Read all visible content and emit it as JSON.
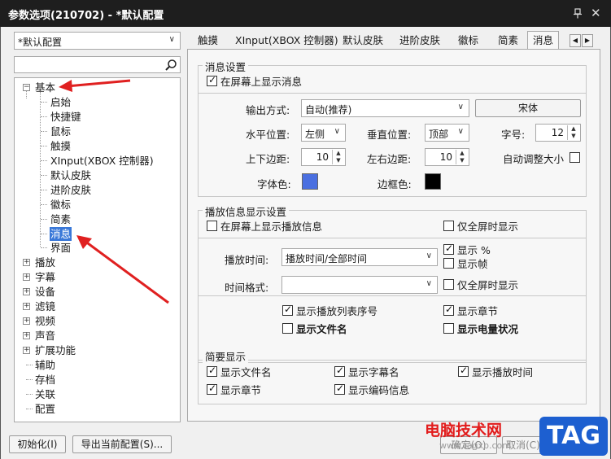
{
  "window": {
    "title": "参数选项(210702) - *默认配置"
  },
  "left": {
    "profile_value": "*默认配置",
    "search_value": "",
    "tree": [
      {
        "label": "基本",
        "expander": "−"
      },
      {
        "label": "启始"
      },
      {
        "label": "快捷键"
      },
      {
        "label": "鼠标"
      },
      {
        "label": "触摸"
      },
      {
        "label": "XInput(XBOX 控制器)"
      },
      {
        "label": "默认皮肤"
      },
      {
        "label": "进阶皮肤"
      },
      {
        "label": "徽标"
      },
      {
        "label": "简素"
      },
      {
        "label": "消息",
        "selected": true
      },
      {
        "label": "界面"
      },
      {
        "label": "播放",
        "expander": "+"
      },
      {
        "label": "字幕",
        "expander": "+"
      },
      {
        "label": "设备",
        "expander": "+"
      },
      {
        "label": "滤镜",
        "expander": "+"
      },
      {
        "label": "视频",
        "expander": "+"
      },
      {
        "label": "声音",
        "expander": "+"
      },
      {
        "label": "扩展功能",
        "expander": "+"
      },
      {
        "label": "辅助"
      },
      {
        "label": "存档"
      },
      {
        "label": "关联"
      },
      {
        "label": "配置"
      }
    ]
  },
  "tabs": [
    "触摸",
    "XInput(XBOX 控制器)",
    "默认皮肤",
    "进阶皮肤",
    "徽标",
    "简素",
    "消息"
  ],
  "message_settings": {
    "title": "消息设置",
    "show_on_screen": {
      "label": "在屏幕上显示消息",
      "checked": true
    },
    "output_label": "输出方式:",
    "output_value": "自动(推荐)",
    "font_button": "宋体",
    "hpos_label": "水平位置:",
    "hpos_value": "左侧",
    "vpos_label": "垂直位置:",
    "vpos_value": "顶部",
    "size_label": "字号:",
    "size_value": "12",
    "vmargin_label": "上下边距:",
    "vmargin_value": "10",
    "hmargin_label": "左右边距:",
    "hmargin_value": "10",
    "autosize": {
      "label": "自动调整大小",
      "checked": false
    },
    "font_color_label": "字体色:",
    "font_color": "#4a6fe0",
    "border_color_label": "边框色:",
    "border_color": "#000000"
  },
  "playinfo": {
    "title": "播放信息显示设置",
    "show_playinfo": {
      "label": "在屏幕上显示播放信息",
      "checked": false
    },
    "fullscreen_only_1": {
      "label": "仅全屏时显示",
      "checked": false
    },
    "playtime_label": "播放时间:",
    "playtime_value": "播放时间/全部时间",
    "show_percent": {
      "label": "显示 %",
      "checked": true
    },
    "show_frame": {
      "label": "显示帧",
      "checked": false
    },
    "timefmt_label": "时间格式:",
    "timefmt_value": "",
    "fullscreen_only_2": {
      "label": "仅全屏时显示",
      "checked": false
    },
    "show_playlist_no": {
      "label": "显示播放列表序号",
      "checked": true
    },
    "show_chapter": {
      "label": "显示章节",
      "checked": true
    },
    "show_filename": {
      "label": "显示文件名",
      "checked": false
    },
    "show_battery": {
      "label": "显示电量状况",
      "checked": false
    }
  },
  "brief": {
    "title": "简要显示",
    "show_filename": {
      "label": "显示文件名",
      "checked": true
    },
    "show_subname": {
      "label": "显示字幕名",
      "checked": true
    },
    "show_playtime": {
      "label": "显示播放时间",
      "checked": true
    },
    "show_chapter": {
      "label": "显示章节",
      "checked": true
    },
    "show_codec": {
      "label": "显示编码信息",
      "checked": true
    }
  },
  "footer": {
    "init_button": "初始化(I)",
    "export_button": "导出当前配置(S)...",
    "ok_button": "确定(O)",
    "cancel_button": "取消(C)"
  },
  "watermark": {
    "site": "电脑技术网",
    "url": "www.tagxp.com",
    "tag": "TAG"
  },
  "colors": {
    "titlebar": "#1e1e1e",
    "selection": "#3a78d8",
    "arrow": "#e02020"
  }
}
